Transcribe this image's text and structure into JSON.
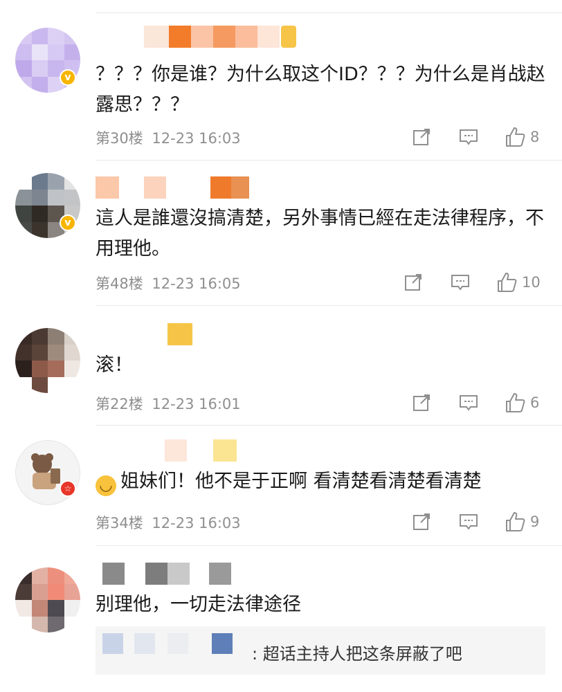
{
  "comments": [
    {
      "text": "？？？你是谁？为什么取这个ID？？？为什么是肖战赵露思？？？",
      "floor": "第30楼",
      "time": "12-23 16:03",
      "likes": "8"
    },
    {
      "text": "這人是誰還沒搞清楚，另外事情已經在走法律程序，不用理他。",
      "floor": "第48楼",
      "time": "12-23 16:05",
      "likes": "10"
    },
    {
      "text": "滚！",
      "floor": "第22楼",
      "time": "12-23 16:01",
      "likes": "6"
    },
    {
      "text": "姐妹们！他不是于正啊 看清楚看清楚看清楚",
      "floor": "第34楼",
      "time": "12-23 16:03",
      "likes": "9"
    },
    {
      "text": "别理他，一切走法律途径",
      "reply": ": 超话主持人把这条屏蔽了吧"
    }
  ],
  "colors": {
    "meta": "#8f8f8f",
    "verified_badge": "#f7b500",
    "red_badge": "#e8362a",
    "level_badge": "#f6c548",
    "divider": "#e8e8e8",
    "reply_bg": "#f5f5f5"
  },
  "icons": [
    "verified-badge-icon",
    "forward-icon",
    "comment-icon",
    "like-icon",
    "upside-down-smile-emoji"
  ]
}
